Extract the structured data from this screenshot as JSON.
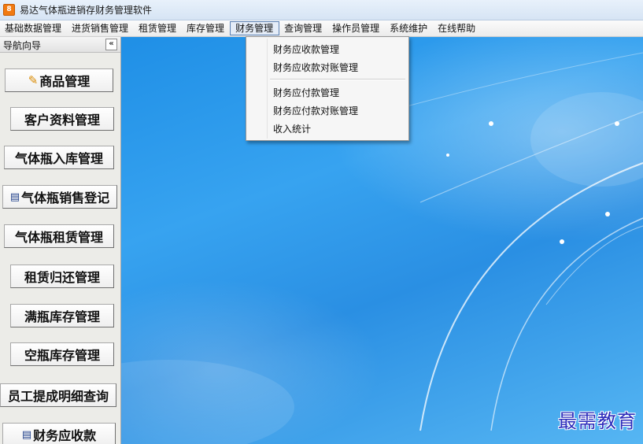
{
  "window": {
    "title": "易达气体瓶进销存财务管理软件",
    "icon_letter": "8"
  },
  "menubar": {
    "items": [
      {
        "label": "基础数据管理"
      },
      {
        "label": "进货销售管理"
      },
      {
        "label": "租赁管理"
      },
      {
        "label": "库存管理"
      },
      {
        "label": "财务管理",
        "active": true
      },
      {
        "label": "查询管理"
      },
      {
        "label": "操作员管理"
      },
      {
        "label": "系统维护"
      },
      {
        "label": "在线帮助"
      }
    ]
  },
  "dropdown": {
    "items": [
      {
        "label": "财务应收款管理"
      },
      {
        "label": "财务应收款对账管理"
      },
      {
        "label": "财务应付款管理"
      },
      {
        "label": "财务应付款对账管理"
      },
      {
        "label": "收入统计"
      }
    ]
  },
  "nav": {
    "title": "导航向导",
    "collapse_glyph": "«",
    "buttons": [
      {
        "label": "商品管理",
        "icon": "goods-icon"
      },
      {
        "label": "客户资料管理"
      },
      {
        "label": "气体瓶入库管理"
      },
      {
        "label": "气体瓶销售登记",
        "icon": "register-icon"
      },
      {
        "label": "气体瓶租赁管理"
      },
      {
        "label": "租赁归还管理"
      },
      {
        "label": "满瓶库存管理"
      },
      {
        "label": "空瓶库存管理"
      },
      {
        "label": "员工提成明细查询"
      },
      {
        "label": "财务应收款",
        "icon": "register-icon"
      }
    ]
  },
  "watermark": "最需教育",
  "colors": {
    "accent": "#2a8fe3",
    "menu_active_border": "#5b80b2",
    "watermark": "#2d2dbb"
  }
}
